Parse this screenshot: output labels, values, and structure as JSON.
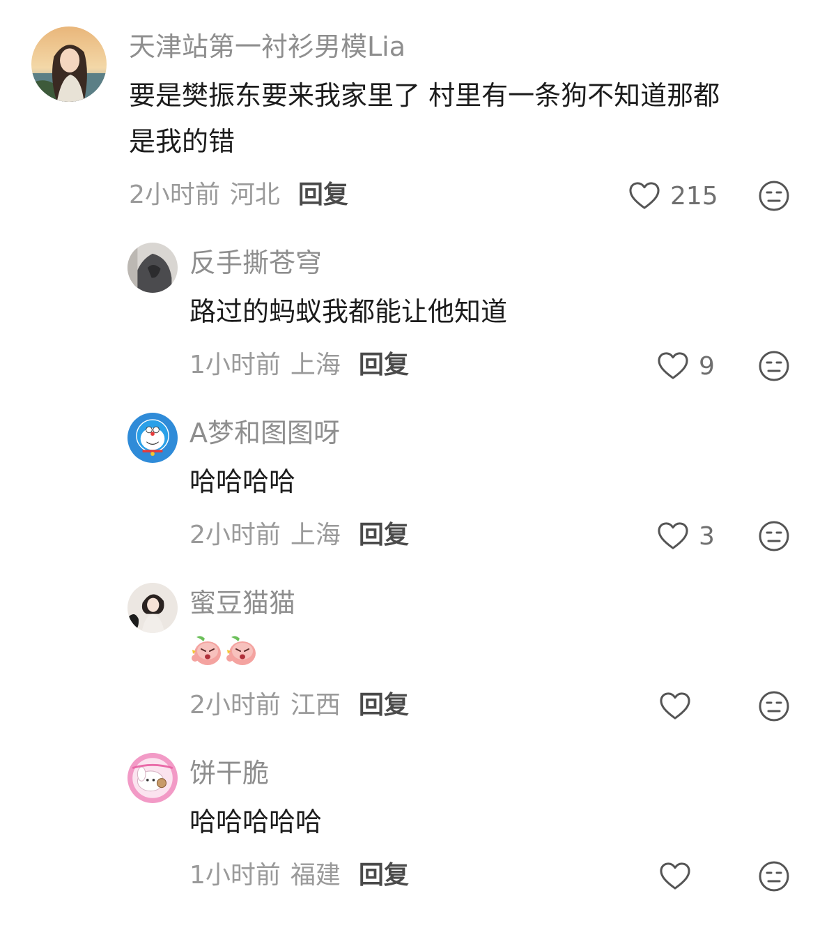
{
  "comments": [
    {
      "username": "天津站第一衬衫男模Lia",
      "lines": [
        "要是樊振东要来我家里了 村里有一条狗不知道那都",
        "是我的错"
      ],
      "time": "2小时前",
      "location": "河北",
      "reply_label": "回复",
      "likes": "215",
      "avatar": "portrait-girl-sunset"
    },
    {
      "username": "反手撕苍穹",
      "text": "路过的蚂蚁我都能让他知道",
      "time": "1小时前",
      "location": "上海",
      "reply_label": "回复",
      "likes": "9",
      "avatar": "hooded-figure"
    },
    {
      "username": "A梦和图图呀",
      "text": "哈哈哈哈",
      "time": "2小时前",
      "location": "上海",
      "reply_label": "回复",
      "likes": "3",
      "avatar": "doraemon"
    },
    {
      "username": "蜜豆猫猫",
      "stickers": [
        "angry-peach-sticker",
        "angry-peach-sticker"
      ],
      "time": "2小时前",
      "location": "江西",
      "reply_label": "回复",
      "likes": "",
      "avatar": "girl-with-black-cat"
    },
    {
      "username": "饼干脆",
      "text": "哈哈哈哈哈",
      "time": "1小时前",
      "location": "福建",
      "reply_label": "回复",
      "likes": "",
      "avatar": "white-puppy-pink-frame"
    }
  ],
  "icons": {
    "like": "heart-outline-icon",
    "dislike": "meh-face-icon"
  },
  "colors": {
    "username": "#8e8e8e",
    "text": "#1c1c1c",
    "meta": "#9a9a9a",
    "reply": "#4a4a4a"
  }
}
